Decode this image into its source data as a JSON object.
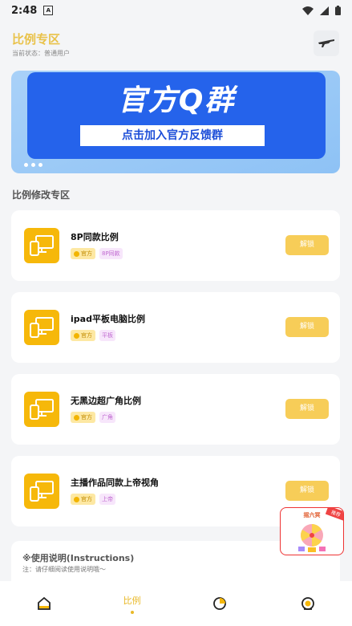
{
  "status_bar": {
    "time": "2:48",
    "notif_letter": "A"
  },
  "header": {
    "title": "比例专区",
    "subtitle": "当前状态：普通用户"
  },
  "banner": {
    "headline": "官方Q群",
    "subline": "点击加入官方反馈群"
  },
  "section_title": "比例修改专区",
  "cards": [
    {
      "title": "8P同款比例",
      "tag1": "官方",
      "tag2": "8P同款",
      "button": "解锁"
    },
    {
      "title": "ipad平板电脑比例",
      "tag1": "官方",
      "tag2": "平板",
      "button": "解锁"
    },
    {
      "title": "无黑边超广角比例",
      "tag1": "官方",
      "tag2": "广角",
      "button": "解锁"
    },
    {
      "title": "主播作品同款上帝视角",
      "tag1": "官方",
      "tag2": "上帝",
      "button": "解锁"
    }
  ],
  "instructions": {
    "title": "※使用说明(Instructions)",
    "note": "注：请仔细阅读使用说明哦～"
  },
  "float_ad": {
    "title": "摇六冥",
    "badge": "推荐"
  },
  "tabbar": {
    "active_label": "比例"
  },
  "colors": {
    "accent": "#e9c24a",
    "icon_bg": "#f6b80a",
    "button": "#f7cd58",
    "banner_blue": "#2563eb"
  }
}
